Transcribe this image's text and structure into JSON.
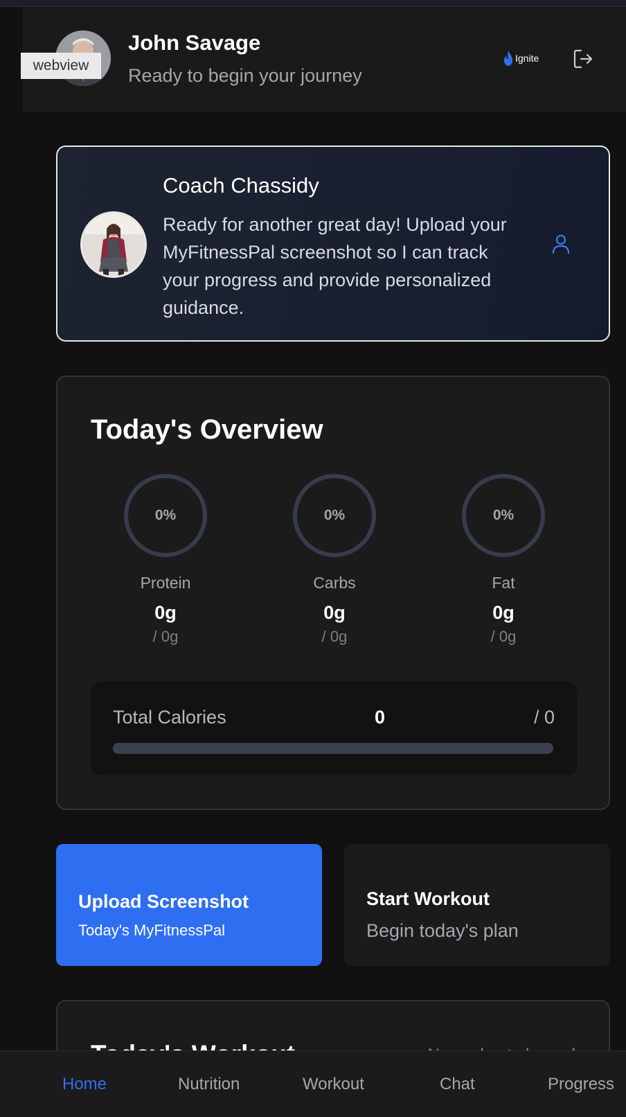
{
  "header": {
    "user_name": "John Savage",
    "user_subtitle": "Ready to begin your journey",
    "webview_label": "webview",
    "brand_name": "Ignite",
    "logout_icon": "logout-icon"
  },
  "coach": {
    "name": "Coach Chassidy",
    "message": "Ready for another great day! Upload your MyFitnessPal screenshot so I can track your progress and provide personalized guidance.",
    "icon": "user-profile-icon"
  },
  "overview": {
    "title": "Today's Overview",
    "macros": [
      {
        "label": "Protein",
        "percent": "0%",
        "value": "0g",
        "goal": "/ 0g"
      },
      {
        "label": "Carbs",
        "percent": "0%",
        "value": "0g",
        "goal": "/ 0g"
      },
      {
        "label": "Fat",
        "percent": "0%",
        "value": "0g",
        "goal": "/ 0g"
      }
    ],
    "calories": {
      "label": "Total Calories",
      "value": "0",
      "goal": "/ 0",
      "progress": 0
    }
  },
  "actions": {
    "upload_title": "Upload Screenshot",
    "upload_subtitle": "Today's MyFitnessPal",
    "workout_title": "Start Workout",
    "workout_subtitle": "Begin today's plan"
  },
  "workout": {
    "title": "Today's Workout",
    "status": "No workout planned"
  },
  "nav": {
    "items": [
      "Home",
      "Nutrition",
      "Workout",
      "Chat",
      "Progress"
    ],
    "active": "Home"
  },
  "colors": {
    "accent": "#2e6ff2",
    "background": "#111111",
    "card": "#1b1b1b"
  }
}
